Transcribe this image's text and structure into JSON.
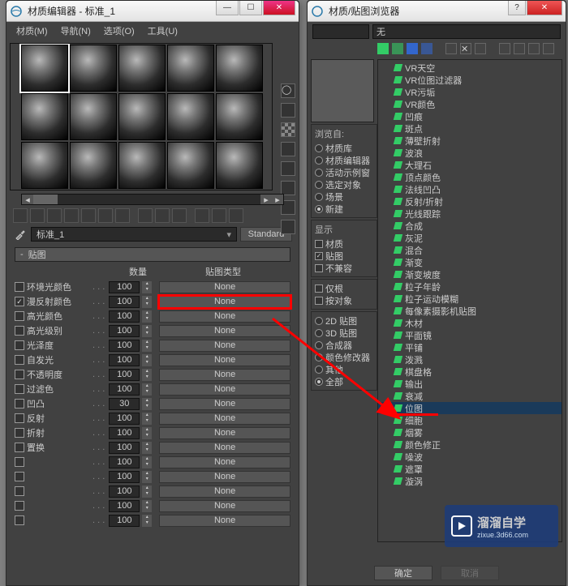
{
  "matEditor": {
    "title": "材质编辑器 - 标准_1",
    "menu": [
      "材质(M)",
      "导航(N)",
      "选项(O)",
      "工具(U)"
    ],
    "currentName": "标准_1",
    "standardBtn": "Standard",
    "rollupTitle": "贴图",
    "colAmount": "数量",
    "colType": "贴图类型",
    "rows": [
      {
        "label": "环境光颜色",
        "amount": "100",
        "checked": false,
        "none": "None"
      },
      {
        "label": "漫反射颜色",
        "amount": "100",
        "checked": true,
        "none": "None",
        "hl": true
      },
      {
        "label": "高光颜色",
        "amount": "100",
        "checked": false,
        "none": "None"
      },
      {
        "label": "高光级别",
        "amount": "100",
        "checked": false,
        "none": "None"
      },
      {
        "label": "光泽度",
        "amount": "100",
        "checked": false,
        "none": "None"
      },
      {
        "label": "自发光",
        "amount": "100",
        "checked": false,
        "none": "None"
      },
      {
        "label": "不透明度",
        "amount": "100",
        "checked": false,
        "none": "None"
      },
      {
        "label": "过滤色",
        "amount": "100",
        "checked": false,
        "none": "None"
      },
      {
        "label": "凹凸",
        "amount": "30",
        "checked": false,
        "none": "None"
      },
      {
        "label": "反射",
        "amount": "100",
        "checked": false,
        "none": "None"
      },
      {
        "label": "折射",
        "amount": "100",
        "checked": false,
        "none": "None"
      },
      {
        "label": "置换",
        "amount": "100",
        "checked": false,
        "none": "None"
      },
      {
        "label": "",
        "amount": "100",
        "checked": false,
        "none": "None"
      },
      {
        "label": "",
        "amount": "100",
        "checked": false,
        "none": "None"
      },
      {
        "label": "",
        "amount": "100",
        "checked": false,
        "none": "None"
      },
      {
        "label": "",
        "amount": "100",
        "checked": false,
        "none": "None"
      },
      {
        "label": "",
        "amount": "100",
        "checked": false,
        "none": "None"
      }
    ]
  },
  "browser": {
    "title": "材质/贴图浏览器",
    "searchValue": "无",
    "browseFrom": {
      "header": "浏览自:",
      "items": [
        {
          "label": "材质库",
          "on": false
        },
        {
          "label": "材质编辑器",
          "on": false
        },
        {
          "label": "活动示例窗",
          "on": false
        },
        {
          "label": "选定对象",
          "on": false
        },
        {
          "label": "场景",
          "on": false
        },
        {
          "label": "新建",
          "on": true
        }
      ]
    },
    "display": {
      "header": "显示",
      "items": [
        {
          "label": "材质",
          "on": false
        },
        {
          "label": "贴图",
          "on": true
        },
        {
          "label": "不兼容",
          "on": false
        }
      ]
    },
    "rootOnly": [
      {
        "label": "仅根",
        "on": false
      },
      {
        "label": "按对象",
        "on": false
      }
    ],
    "filters": [
      {
        "label": "2D 贴图",
        "on": false
      },
      {
        "label": "3D 贴图",
        "on": false
      },
      {
        "label": "合成器",
        "on": false
      },
      {
        "label": "颜色修改器",
        "on": false
      },
      {
        "label": "其他",
        "on": false
      },
      {
        "label": "全部",
        "on": true
      }
    ],
    "tree": [
      "VR天空",
      "VR位图过滤器",
      "VR污垢",
      "VR颜色",
      "凹痕",
      "斑点",
      "薄壁折射",
      "波浪",
      "大理石",
      "顶点颜色",
      "法线凹凸",
      "反射/折射",
      "光线跟踪",
      "合成",
      "灰泥",
      "混合",
      "渐变",
      "渐变坡度",
      "粒子年龄",
      "粒子运动模糊",
      "每像素摄影机贴图",
      "木材",
      "平面镜",
      "平铺",
      "泼溅",
      "棋盘格",
      "输出",
      "衰减",
      "位图",
      "细胞",
      "烟雾",
      "颜色修正",
      "噪波",
      "遮罩",
      "漩涡"
    ],
    "highlightIndex": 28,
    "ok": "确定",
    "cancel": "取消"
  },
  "logo": {
    "t1": "溜溜自学",
    "t2": "zixue.3d66.com"
  }
}
